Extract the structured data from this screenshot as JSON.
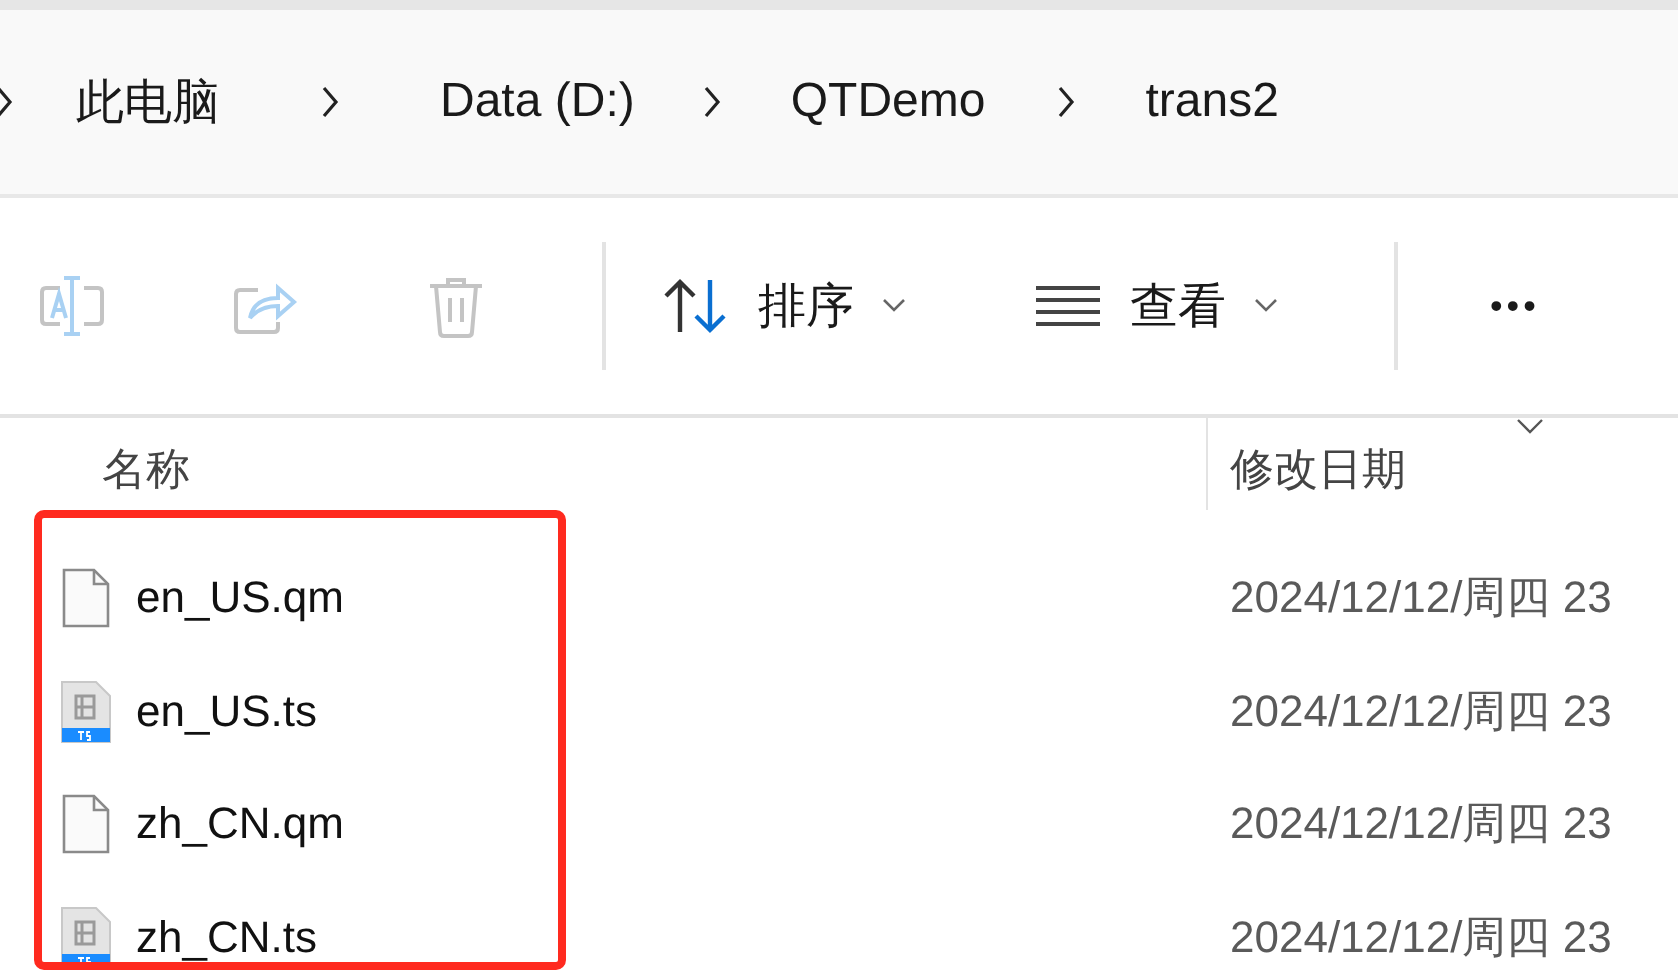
{
  "breadcrumb": [
    {
      "label": "此电脑"
    },
    {
      "label": "Data (D:)"
    },
    {
      "label": "QTDemo"
    },
    {
      "label": "trans2"
    }
  ],
  "toolbar": [
    {
      "kind": "icon-button",
      "disabled": true
    },
    {
      "kind": "icon-button",
      "disabled": true
    },
    {
      "kind": "icon-button",
      "disabled": true
    },
    {
      "kind": "divider"
    },
    {
      "kind": "menu",
      "label": "排序"
    },
    {
      "kind": "menu",
      "label": "查看"
    },
    {
      "kind": "divider"
    },
    {
      "kind": "more",
      "label": "•••"
    }
  ],
  "columns": [
    {
      "label": "名称",
      "sorted": false
    },
    {
      "label": "修改日期",
      "sorted": true
    }
  ],
  "files": [
    {
      "kind": "qm",
      "name": "en_US.qm",
      "modified": "2024/12/12/周四 23"
    },
    {
      "kind": "ts",
      "name": "en_US.ts",
      "modified": "2024/12/12/周四 23"
    },
    {
      "kind": "qm",
      "name": "zh_CN.qm",
      "modified": "2024/12/12/周四 23"
    },
    {
      "kind": "ts",
      "name": "zh_CN.ts",
      "modified": "2024/12/12/周四 23"
    }
  ]
}
